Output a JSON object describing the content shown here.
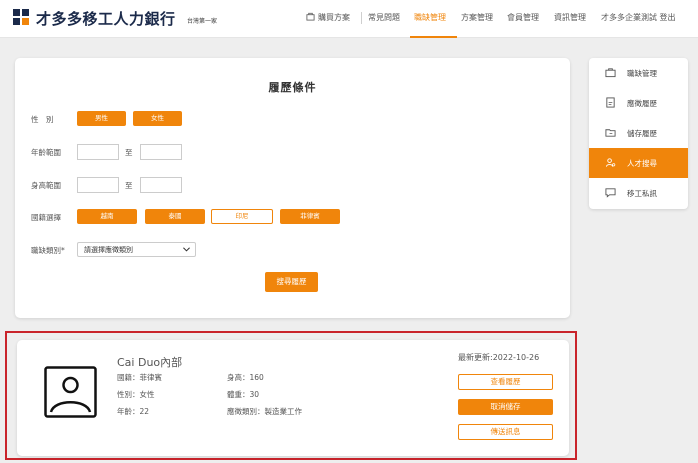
{
  "header": {
    "logo_text": "才多多移工人力銀行",
    "logo_subtext": "台灣第一家",
    "nav": [
      {
        "label": "購買方案"
      },
      {
        "label": "常見問題"
      },
      {
        "label": "職缺管理"
      },
      {
        "label": "方案管理"
      },
      {
        "label": "會員管理"
      },
      {
        "label": "資訊管理"
      },
      {
        "label": "才多多企業測試 登出"
      }
    ],
    "active_color": "#f0850b"
  },
  "criteria": {
    "title": "履歷條件",
    "gender": {
      "label": "性　別",
      "options": [
        "男性",
        "女性"
      ]
    },
    "age": {
      "label": "年齡範圍",
      "separator": "至"
    },
    "height": {
      "label": "身高範圍",
      "separator": "至"
    },
    "nationality": {
      "label": "國籍選擇",
      "options": [
        "越南",
        "泰國",
        "印尼",
        "菲律賓"
      ]
    },
    "job_category": {
      "label": "職缺類別*",
      "placeholder": "請選擇應徵類別"
    },
    "search_button": "搜尋履歷"
  },
  "sidebar": {
    "items": [
      {
        "label": "職缺管理",
        "icon": "briefcase-icon"
      },
      {
        "label": "應徵履歷",
        "icon": "document-icon"
      },
      {
        "label": "儲存履歷",
        "icon": "folder-icon"
      },
      {
        "label": "人才搜尋",
        "icon": "people-search-icon"
      },
      {
        "label": "移工私訊",
        "icon": "chat-icon"
      }
    ]
  },
  "result": {
    "name": "Cai Duo內部",
    "nationality": "國籍：菲律賓",
    "gender": "性別：女性",
    "age": "年齡：22",
    "height": "身高：160",
    "weight": "體重：30",
    "category": "應徵類別：製造業工作",
    "updated": "最新更新:2022-10-26",
    "view_button": "查看履歷",
    "unsave_button": "取消儲存",
    "message_button": "傳送訊息"
  }
}
